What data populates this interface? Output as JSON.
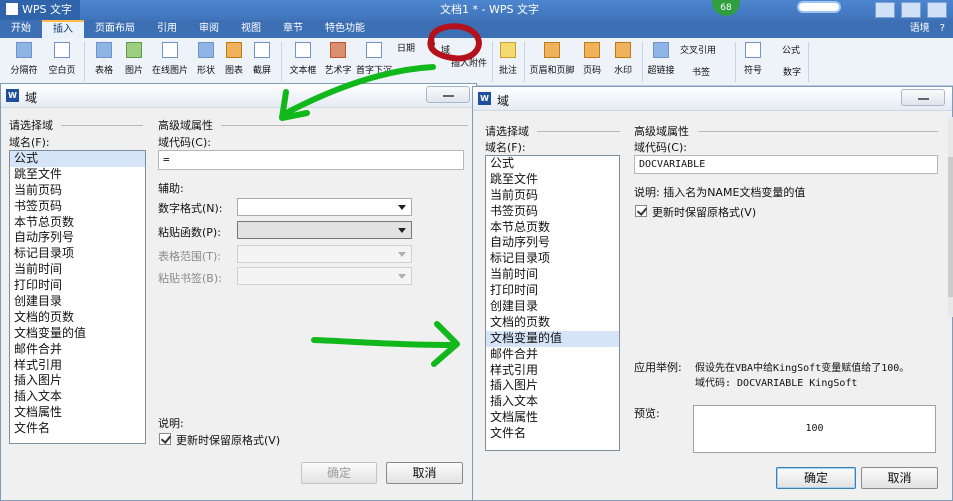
{
  "app": {
    "brand": "WPS 文字",
    "doc_title": "文档1 * - WPS 文字",
    "badge": "68"
  },
  "menu": {
    "items": [
      "开始",
      "插入",
      "页面布局",
      "引用",
      "审阅",
      "视图",
      "章节",
      "特色功能"
    ],
    "active": "插入",
    "right_items": [
      "语境",
      "?"
    ]
  },
  "ribbon": {
    "items": [
      "分隔符",
      "空白页",
      "表格",
      "图片",
      "在线图片",
      "形状",
      "图表",
      "截屏",
      "文本框",
      "艺术字",
      "首字下沉",
      "插入附件",
      "批注",
      "页眉和页脚",
      "页码",
      "水印",
      "超链接",
      "书签",
      "符号",
      "数字"
    ],
    "small_items": [
      "日期",
      "域",
      "交叉引用",
      "公式",
      "对象"
    ]
  },
  "left_dialog": {
    "title": "域",
    "choose_field": "请选择域",
    "field_name": "域名(F):",
    "items": [
      "公式",
      "跳至文件",
      "当前页码",
      "书签页码",
      "本节总页数",
      "自动序列号",
      "标记目录项",
      "当前时间",
      "打印时间",
      "创建目录",
      "文档的页数",
      "文档变量的值",
      "邮件合并",
      "样式引用",
      "插入图片",
      "插入文本",
      "文档属性",
      "文件名"
    ],
    "selected": "公式",
    "advanced": "高级域属性",
    "field_code_label": "域代码(C):",
    "field_code_value": "=",
    "assist": "辅助:",
    "number_format": "数字格式(N):",
    "paste_function": "粘贴函数(P):",
    "table_range": "表格范围(T):",
    "paste_bookmark": "粘贴书签(B):",
    "explain": "说明:",
    "keep_format": "更新时保留原格式(V)",
    "ok": "确定",
    "cancel": "取消"
  },
  "right_dialog": {
    "title": "域",
    "choose_field": "请选择域",
    "field_name": "域名(F):",
    "items": [
      "公式",
      "跳至文件",
      "当前页码",
      "书签页码",
      "本节总页数",
      "自动序列号",
      "标记目录项",
      "当前时间",
      "打印时间",
      "创建目录",
      "文档的页数",
      "文档变量的值",
      "邮件合并",
      "样式引用",
      "插入图片",
      "插入文本",
      "文档属性",
      "文件名"
    ],
    "selected": "文档变量的值",
    "advanced": "高级域属性",
    "field_code_label": "域代码(C):",
    "field_code_value": "DOCVARIABLE",
    "explain": "说明: 插入名为NAME文档变量的值",
    "keep_format": "更新时保留原格式(V)",
    "example_label": "应用举例:",
    "example_line1": "假设先在VBA中给KingSoft变量赋值给了100。",
    "example_line2": "域代码: DOCVARIABLE KingSoft",
    "preview_label": "预览:",
    "preview_value": "100",
    "ok": "确定",
    "cancel": "取消"
  },
  "colors": {
    "title_bar": "#4c86cf",
    "menu_bar": "#3d6fb5",
    "selected_item": "#d6e4f7",
    "annotation_green": "#11b81b",
    "annotation_red": "#b3111b"
  }
}
